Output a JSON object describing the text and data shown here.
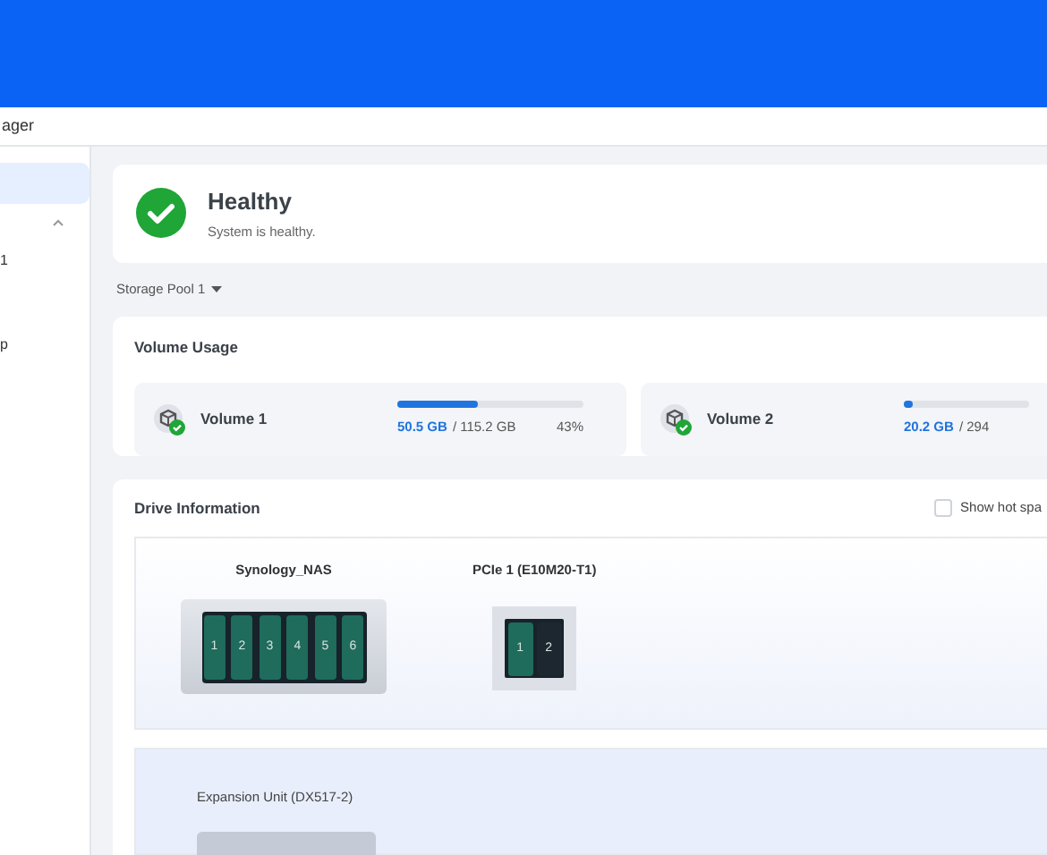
{
  "window": {
    "title": "ager"
  },
  "sidebar": {
    "items": [
      {
        "selected": true
      },
      {
        "label": "1",
        "selected": false
      },
      {
        "label": "p",
        "selected": false
      }
    ],
    "group_expanded": true
  },
  "health": {
    "title": "Healthy",
    "message": "System is healthy."
  },
  "pool_selector": {
    "label": "Storage Pool 1"
  },
  "volume_usage": {
    "title": "Volume Usage",
    "volumes": [
      {
        "name": "Volume 1",
        "used": "50.5 GB",
        "total": "/ 115.2 GB",
        "percent": "43%",
        "level": 0.43
      },
      {
        "name": "Volume 2",
        "used": "20.2 GB",
        "total": "/ 294",
        "level": 0.07
      }
    ]
  },
  "drive_info": {
    "title": "Drive Information",
    "show_hot_spare": {
      "label": "Show hot spa",
      "checked": false
    },
    "devices": [
      {
        "name": "Synology_NAS",
        "kind": "nas",
        "slots": [
          {
            "label": "1",
            "occupied": true
          },
          {
            "label": "2",
            "occupied": true
          },
          {
            "label": "3",
            "occupied": true
          },
          {
            "label": "4",
            "occupied": true
          },
          {
            "label": "5",
            "occupied": true
          },
          {
            "label": "6",
            "occupied": true
          }
        ]
      },
      {
        "name": "PCIe 1 (E10M20-T1)",
        "kind": "card",
        "slots": [
          {
            "label": "1",
            "occupied": true
          },
          {
            "label": "2",
            "occupied": false
          }
        ]
      }
    ],
    "expansion": {
      "name": "Expansion Unit (DX517-2)"
    }
  }
}
